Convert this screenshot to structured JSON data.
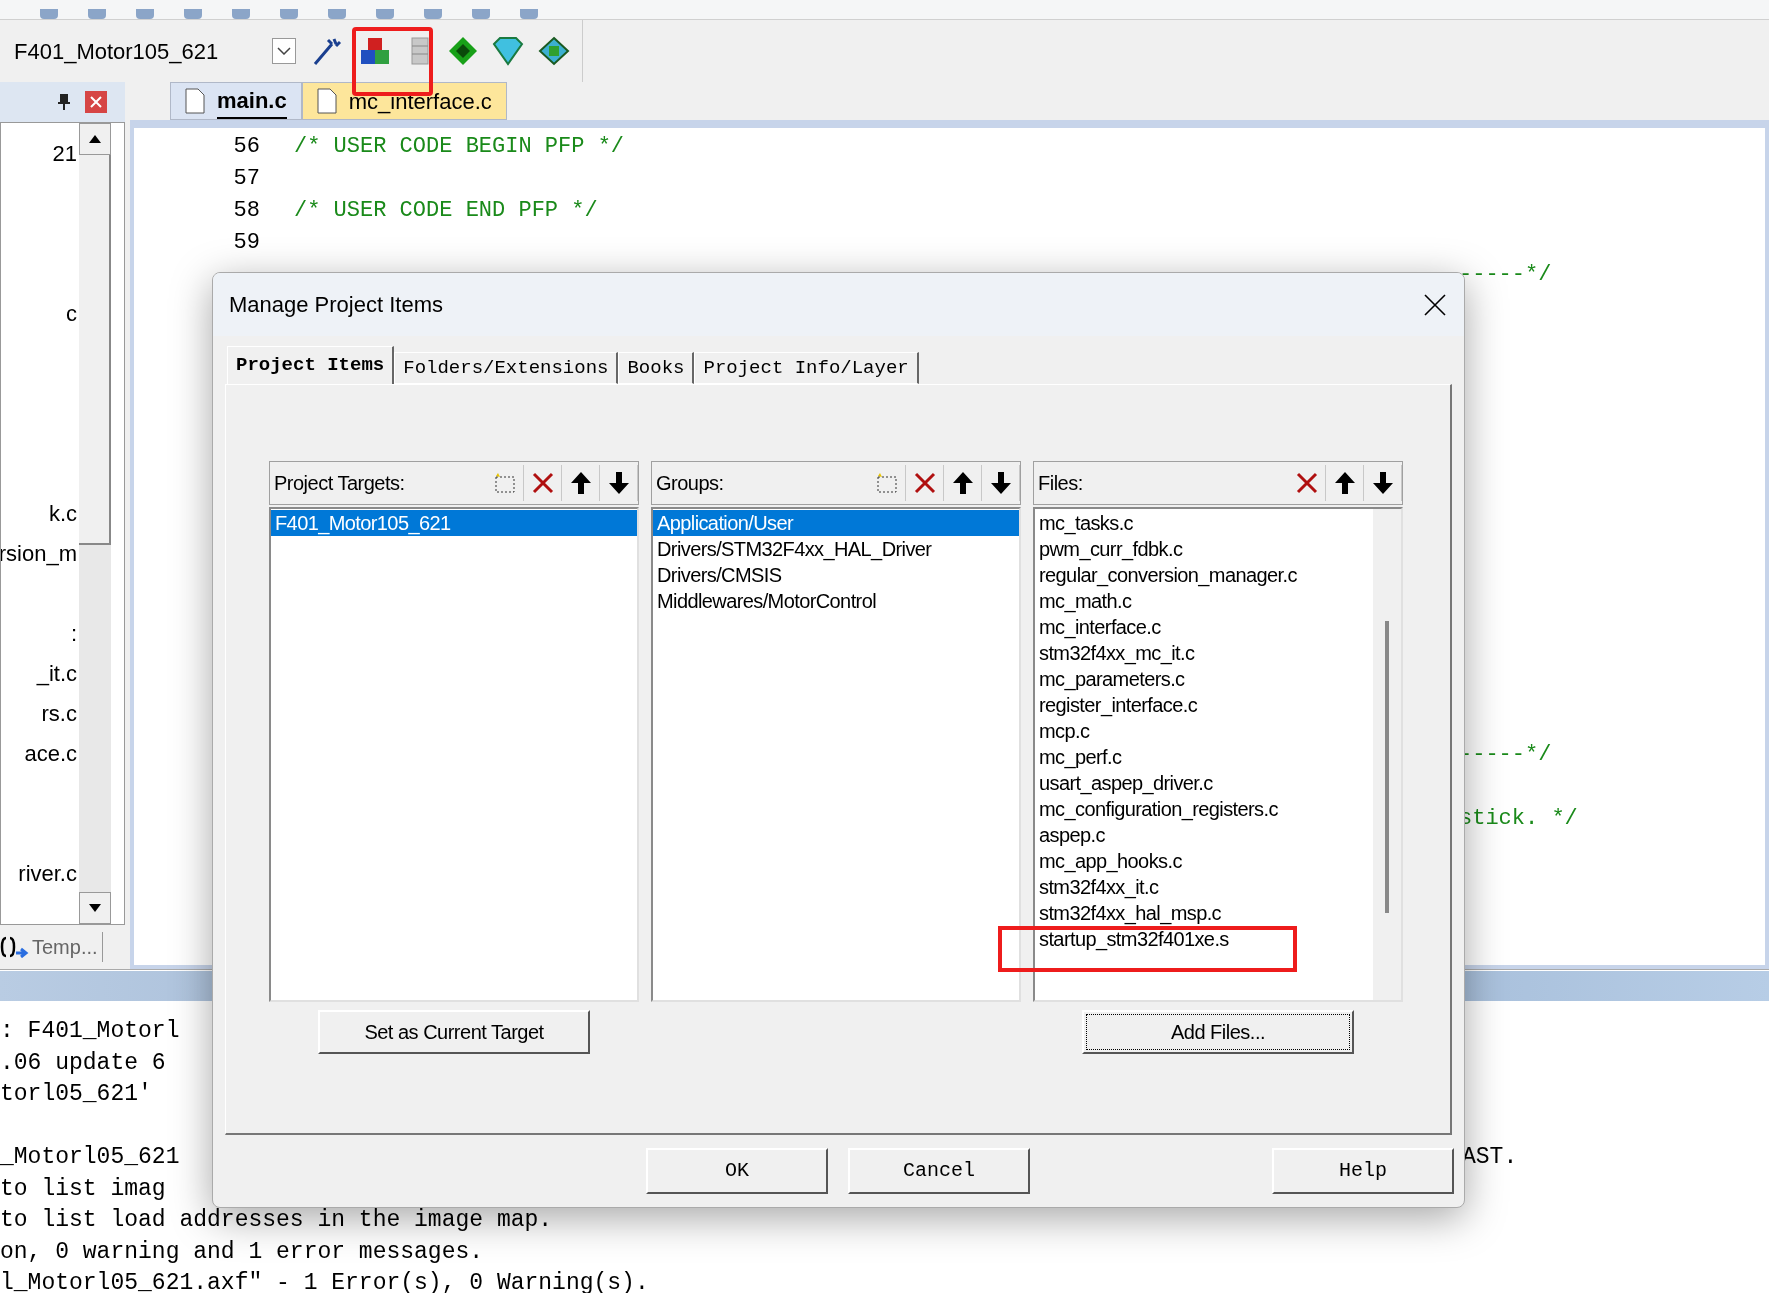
{
  "toolbar": {
    "target": "F401_Motor105_621"
  },
  "editor_tabs": [
    {
      "label": "main.c",
      "selected": true
    },
    {
      "label": "mc_interface.c",
      "selected": false
    }
  ],
  "project_panel": {
    "items": [
      "21",
      "c",
      "k.c",
      "rsion_m",
      ":",
      "_it.c",
      "rs.c",
      "ace.c",
      "river.c"
    ],
    "bottom_tab": "Temp..."
  },
  "code_lines": [
    {
      "number": "56",
      "text": "/* USER CODE BEGIN PFP */"
    },
    {
      "number": "57"
    },
    {
      "number": "58",
      "text": "/* USER CODE END PFP */"
    },
    {
      "number": "59"
    }
  ],
  "code_fragments": [
    "-----*/",
    "-----*/",
    "stick. */"
  ],
  "output_lines": [
    ": F401_Motorl",
    ".06 update 6",
    "torl05_621'",
    "_Motorl05_621",
    "to list imag",
    "to list load addresses in the image map.",
    "on, 0 warning and 1 error messages.",
    "l_Motorl05_621.axf\" - 1 Error(s), 0 Warning(s)."
  ],
  "output_fragment": "AST.",
  "dialog": {
    "title": "Manage Project Items",
    "tabs": [
      {
        "label": "Project Items",
        "selected": true
      },
      {
        "label": "Folders/Extensions",
        "selected": false
      },
      {
        "label": "Books",
        "selected": false
      },
      {
        "label": "Project Info/Layer",
        "selected": false
      }
    ],
    "panels": [
      {
        "label": "Project Targets:",
        "tools": [
          {
            "kind": "new"
          },
          {
            "kind": "delete"
          },
          {
            "kind": "up"
          },
          {
            "kind": "down"
          }
        ],
        "items": [
          {
            "label": "F401_Motor105_621",
            "selected": true
          }
        ],
        "button": "Set as Current Target"
      },
      {
        "label": "Groups:",
        "tools": [
          {
            "kind": "new"
          },
          {
            "kind": "delete"
          },
          {
            "kind": "up"
          },
          {
            "kind": "down"
          }
        ],
        "items": [
          {
            "label": "Application/User",
            "selected": true
          },
          {
            "label": "Drivers/STM32F4xx_HAL_Driver",
            "selected": false
          },
          {
            "label": "Drivers/CMSIS",
            "selected": false
          },
          {
            "label": "Middlewares/MotorControl",
            "selected": false
          }
        ]
      },
      {
        "label": "Files:",
        "tools": [
          {
            "kind": "delete"
          },
          {
            "kind": "up"
          },
          {
            "kind": "down"
          }
        ],
        "items": [
          {
            "label": "mc_tasks.c",
            "selected": false
          },
          {
            "label": "pwm_curr_fdbk.c",
            "selected": false
          },
          {
            "label": "regular_conversion_manager.c",
            "selected": false
          },
          {
            "label": "mc_math.c",
            "selected": false
          },
          {
            "label": "mc_interface.c",
            "selected": false
          },
          {
            "label": "stm32f4xx_mc_it.c",
            "selected": false
          },
          {
            "label": "mc_parameters.c",
            "selected": false
          },
          {
            "label": "register_interface.c",
            "selected": false
          },
          {
            "label": "mcp.c",
            "selected": false
          },
          {
            "label": "mc_perf.c",
            "selected": false
          },
          {
            "label": "usart_aspep_driver.c",
            "selected": false
          },
          {
            "label": "mc_configuration_registers.c",
            "selected": false
          },
          {
            "label": "aspep.c",
            "selected": false
          },
          {
            "label": "mc_app_hooks.c",
            "selected": false
          },
          {
            "label": "stm32f4xx_it.c",
            "selected": false
          },
          {
            "label": "stm32f4xx_hal_msp.c",
            "selected": false
          },
          {
            "label": "startup_stm32f401xe.s",
            "selected": false
          }
        ],
        "button": "Add Files..."
      }
    ],
    "buttons": [
      {
        "label": "OK"
      },
      {
        "label": "Cancel"
      },
      {
        "label": "Help"
      }
    ]
  }
}
